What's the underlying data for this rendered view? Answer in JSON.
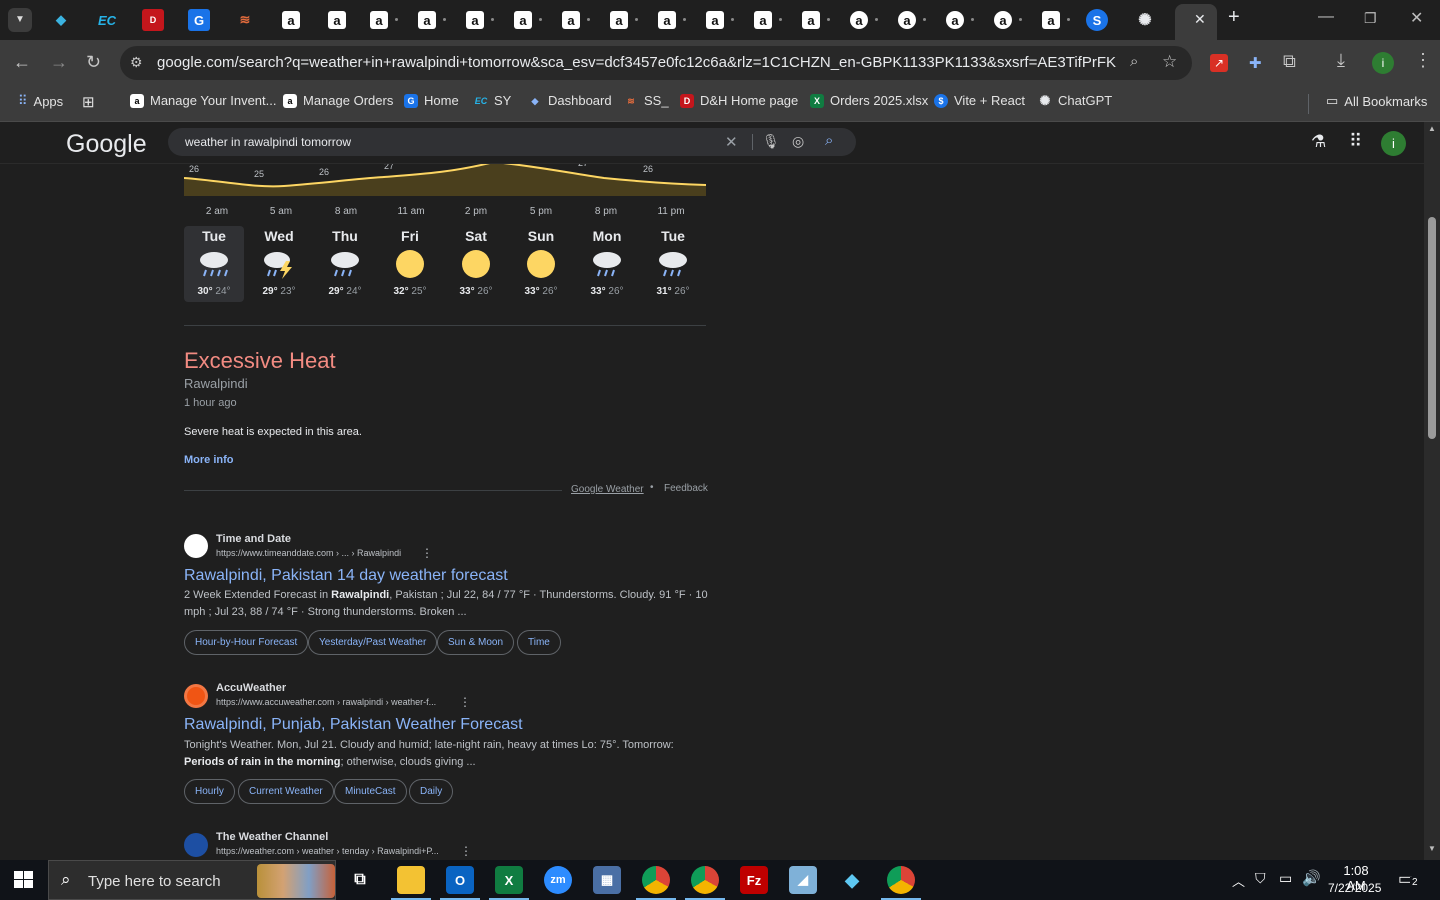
{
  "tabbar": {
    "tab_glyphs": [
      "EC",
      "D",
      "G",
      "a",
      "a",
      "a",
      "a",
      "a",
      "a",
      "a",
      "a",
      "a",
      "a",
      "a",
      "a",
      "a",
      "a",
      "a",
      "a",
      "a",
      "S"
    ],
    "new_tab": "+"
  },
  "toolbar": {
    "url": "google.com/search?q=weather+in+rawalpindi+tomorrow&sca_esv=dcf3457e0fc12c6a&rlz=1C1CHZN_en-GBPK1133PK1133&sxsrf=AE3TifPrFKbJvwpM2ll..."
  },
  "bookmarks": [
    {
      "label": "Apps",
      "icon": "apps-grid-icon"
    },
    {
      "label": "Manage Your Invent...",
      "icon": "amazon-icon"
    },
    {
      "label": "Manage Orders",
      "icon": "amazon-icon"
    },
    {
      "label": "Home",
      "icon": "home-icon"
    },
    {
      "label": "SY",
      "icon": "ec-icon"
    },
    {
      "label": "Dashboard",
      "icon": "dashboard-icon"
    },
    {
      "label": "SS_",
      "icon": "ss-icon"
    },
    {
      "label": "D&H Home page",
      "icon": "dh-icon"
    },
    {
      "label": "Orders 2025.xlsx",
      "icon": "excel-icon"
    },
    {
      "label": "Vite + React",
      "icon": "vite-icon"
    },
    {
      "label": "ChatGPT",
      "icon": "chatgpt-icon"
    }
  ],
  "all_bookmarks": "All Bookmarks",
  "google": {
    "logo": "Google",
    "query": "weather in rawalpindi tomorrow"
  },
  "weather": {
    "chart_temps": [
      "26",
      "25",
      "26",
      "27",
      "27",
      "26"
    ],
    "times": [
      "2 am",
      "5 am",
      "8 am",
      "11 am",
      "2 pm",
      "5 pm",
      "8 pm",
      "11 pm"
    ],
    "days": [
      {
        "name": "Tue",
        "hi": "30°",
        "lo": "24°",
        "icon": "rain-icon"
      },
      {
        "name": "Wed",
        "hi": "29°",
        "lo": "23°",
        "icon": "thunderstorm-icon"
      },
      {
        "name": "Thu",
        "hi": "29°",
        "lo": "24°",
        "icon": "rain-icon"
      },
      {
        "name": "Fri",
        "hi": "32°",
        "lo": "25°",
        "icon": "sun-icon"
      },
      {
        "name": "Sat",
        "hi": "33°",
        "lo": "26°",
        "icon": "sun-icon"
      },
      {
        "name": "Sun",
        "hi": "33°",
        "lo": "26°",
        "icon": "sun-icon"
      },
      {
        "name": "Mon",
        "hi": "33°",
        "lo": "26°",
        "icon": "rain-icon"
      },
      {
        "name": "Tue",
        "hi": "31°",
        "lo": "26°",
        "icon": "rain-icon"
      }
    ]
  },
  "alert": {
    "title": "Excessive Heat",
    "location": "Rawalpindi",
    "time": "1 hour ago",
    "description": "Severe heat is expected in this area.",
    "more_info": "More info",
    "source": "Google Weather",
    "feedback": "Feedback"
  },
  "results": [
    {
      "site": "Time and Date",
      "url": "https://www.timeanddate.com › ... › Rawalpindi",
      "title": "Rawalpindi, Pakistan 14 day weather forecast",
      "snippet_1": "2 Week Extended Forecast in ",
      "snippet_bold": "Rawalpindi",
      "snippet_2": ", Pakistan ; Jul 22, 84 / 77 °F · Thunderstorms. Cloudy. 91 °F · 10 mph ; Jul 23, 88 / 74 °F · Strong thunderstorms. Broken ...",
      "chips": [
        "Hour-by-Hour Forecast",
        "Yesterday/Past Weather",
        "Sun & Moon",
        "Time"
      ]
    },
    {
      "site": "AccuWeather",
      "url": "https://www.accuweather.com › rawalpindi › weather-f...",
      "title": "Rawalpindi, Punjab, Pakistan Weather Forecast",
      "snippet_1": "Tonight's Weather. Mon, Jul 21. Cloudy and humid; late-night rain, heavy at times Lo: 75°. Tomorrow: ",
      "snippet_bold": "Periods of rain in the morning",
      "snippet_2": "; otherwise, clouds giving ...",
      "chips": [
        "Hourly",
        "Current Weather",
        "MinuteCast",
        "Daily"
      ]
    },
    {
      "site": "The Weather Channel",
      "url": "https://weather.com › weather › tenday › Rawalpindi+P..."
    }
  ],
  "taskbar": {
    "search_placeholder": "Type here to search",
    "time": "1:08 AM",
    "date": "7/22/2025",
    "notifications": "2"
  }
}
